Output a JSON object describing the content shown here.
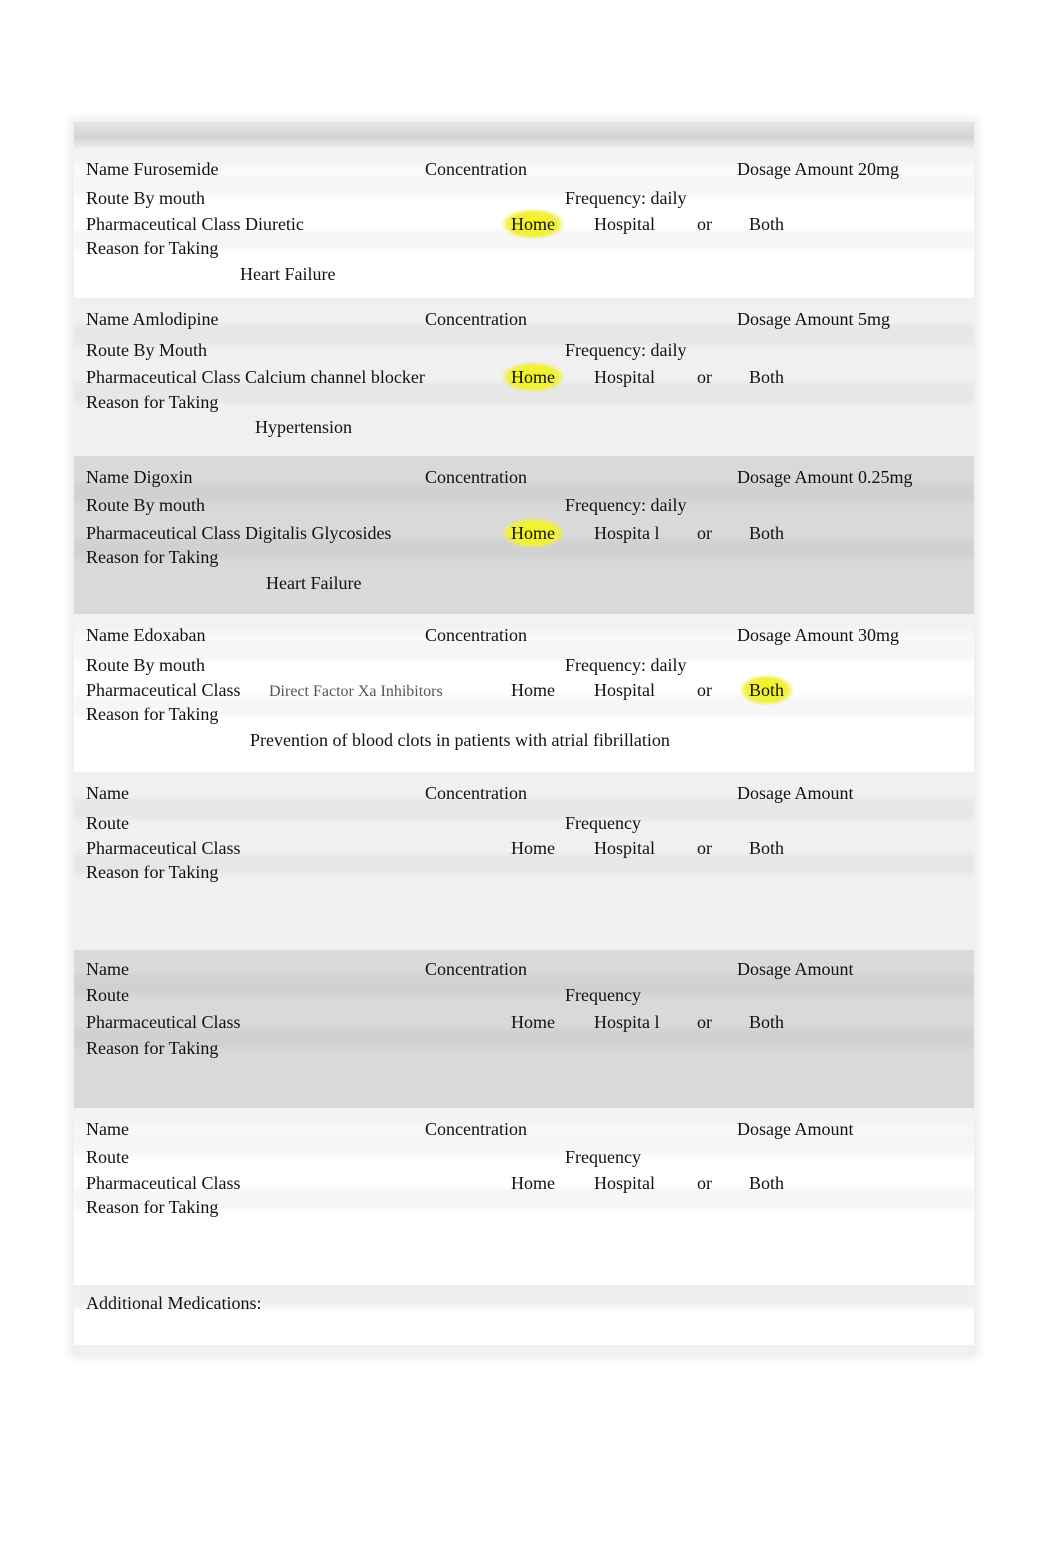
{
  "form": {
    "labels": {
      "name": "Name",
      "concentration": "Concentration",
      "dosage_amount": "Dosage Amount",
      "route": "Route",
      "frequency": "Frequency",
      "pharm_class": "Pharmaceutical Class",
      "home": "Home",
      "hospital": "Hospital",
      "hospital_split": "Hospita l",
      "or": "or",
      "both": "Both",
      "reason": "Reason for Taking"
    },
    "medications": [
      {
        "name_line": "Name Furosemide",
        "concentration_line": "Concentration",
        "dosage_line": "Dosage Amount 20mg",
        "route_line": "Route By mouth",
        "frequency_line": "Frequency: daily",
        "class_line": "Pharmaceutical Class Diuretic",
        "class_value_note": "",
        "home": "Home",
        "hospital": "Hospital",
        "or": "or",
        "both": "Both",
        "selected": "Home",
        "reason_label": "Reason for Taking",
        "reason_value": "Heart Failure"
      },
      {
        "name_line": "Name Amlodipine",
        "concentration_line": "Concentration",
        "dosage_line": "Dosage Amount 5mg",
        "route_line": "Route By Mouth",
        "frequency_line": "Frequency: daily",
        "class_line": "Pharmaceutical Class Calcium channel blocker",
        "class_value_note": "",
        "home": "Home",
        "hospital": "Hospital",
        "or": "or",
        "both": "Both",
        "selected": "Home",
        "reason_label": "Reason for Taking",
        "reason_value": "Hypertension"
      },
      {
        "name_line": "Name Digoxin",
        "concentration_line": "Concentration",
        "dosage_line": "Dosage Amount 0.25mg",
        "route_line": "Route By mouth",
        "frequency_line": "Frequency: daily",
        "class_line": "Pharmaceutical Class Digitalis Glycosides",
        "class_value_note": "",
        "home": "Home",
        "hospital": "Hospita l",
        "or": "or",
        "both": "Both",
        "selected": "Home",
        "reason_label": "Reason for Taking",
        "reason_value": "Heart Failure"
      },
      {
        "name_line": "Name Edoxaban",
        "concentration_line": "Concentration",
        "dosage_line": "Dosage Amount 30mg",
        "route_line": "Route By mouth",
        "frequency_line": "Frequency: daily",
        "class_line": "Pharmaceutical Class",
        "class_value_note": "Direct Factor Xa Inhibitors",
        "home": "Home",
        "hospital": "Hospital",
        "or": "or",
        "both": "Both",
        "selected": "Both",
        "reason_label": "Reason for Taking",
        "reason_value": "Prevention of blood clots in patients with atrial fibrillation"
      },
      {
        "name_line": "Name",
        "concentration_line": "Concentration",
        "dosage_line": "Dosage Amount",
        "route_line": "Route",
        "frequency_line": "Frequency",
        "class_line": "Pharmaceutical Class",
        "class_value_note": "",
        "home": "Home",
        "hospital": "Hospital",
        "or": "or",
        "both": "Both",
        "selected": "",
        "reason_label": "Reason for Taking",
        "reason_value": ""
      },
      {
        "name_line": "Name",
        "concentration_line": "Concentration",
        "dosage_line": "Dosage Amount",
        "route_line": "Route",
        "frequency_line": "Frequency",
        "class_line": "Pharmaceutical Class",
        "class_value_note": "",
        "home": "Home",
        "hospital": "Hospita l",
        "or": "or",
        "both": "Both",
        "selected": "",
        "reason_label": "Reason for Taking",
        "reason_value": ""
      },
      {
        "name_line": "Name",
        "concentration_line": "Concentration",
        "dosage_line": "Dosage Amount",
        "route_line": "Route",
        "frequency_line": "Frequency",
        "class_line": "Pharmaceutical Class",
        "class_value_note": "",
        "home": "Home",
        "hospital": "Hospital",
        "or": "or",
        "both": "Both",
        "selected": "",
        "reason_label": "Reason for Taking",
        "reason_value": ""
      }
    ],
    "additional_medications_label": "Additional Medications:",
    "additional_medications_value": "",
    "highlight_color": "#f2f21e"
  }
}
